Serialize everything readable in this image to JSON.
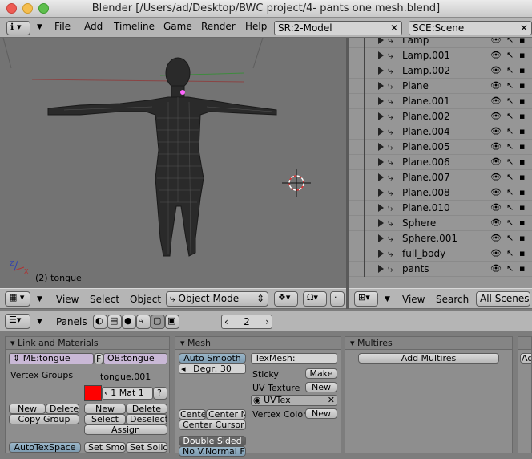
{
  "window": {
    "title": "Blender [/Users/ad/Desktop/BWC project/4- pants one mesh.blend]"
  },
  "topbar": {
    "menus": [
      "File",
      "Add",
      "Timeline",
      "Game",
      "Render",
      "Help"
    ],
    "screen_field": "SR:2-Model",
    "scene_field": "SCE:Scene"
  },
  "viewport": {
    "object_label": "(2) tongue"
  },
  "viewport_header": {
    "menus": [
      "View",
      "Select",
      "Object"
    ],
    "mode": "Object Mode"
  },
  "outliner": {
    "items": [
      {
        "name": "Lamp"
      },
      {
        "name": "Lamp.001"
      },
      {
        "name": "Lamp.002"
      },
      {
        "name": "Plane"
      },
      {
        "name": "Plane.001"
      },
      {
        "name": "Plane.002"
      },
      {
        "name": "Plane.004"
      },
      {
        "name": "Plane.005"
      },
      {
        "name": "Plane.006"
      },
      {
        "name": "Plane.007"
      },
      {
        "name": "Plane.008"
      },
      {
        "name": "Plane.010"
      },
      {
        "name": "Sphere"
      },
      {
        "name": "Sphere.001"
      },
      {
        "name": "full_body"
      },
      {
        "name": "pants"
      }
    ]
  },
  "outliner_header": {
    "menus": [
      "View",
      "Search"
    ],
    "scope": "All Scenes"
  },
  "buttons_header": {
    "panels_label": "Panels",
    "frame_value": "2"
  },
  "link_materials": {
    "title": "Link and Materials",
    "mesh_field": "ME:tongue",
    "f_label": "F",
    "object_field": "OB:tongue",
    "vertex_groups_label": "Vertex Groups",
    "material_name": "tongue.001",
    "mat_label": "1 Mat 1",
    "question_label": "?",
    "vg_new": "New",
    "vg_delete": "Delete",
    "copy_group": "Copy Group",
    "mat_new": "New",
    "mat_delete": "Delete",
    "mat_select": "Select",
    "mat_deselect": "Deselect",
    "assign": "Assign",
    "autotexspace": "AutoTexSpace",
    "set_smooth": "Set Smoo",
    "set_solid": "Set Solid",
    "material_color": "#ff0000"
  },
  "mesh": {
    "title": "Mesh",
    "auto_smooth": "Auto Smooth",
    "degr": "Degr: 30",
    "texmesh": "TexMesh:",
    "sticky": "Sticky",
    "sticky_btn": "Make",
    "uv_texture": "UV Texture",
    "uv_btn": "New",
    "uvtex_name": "UVTex",
    "vertex_color": "Vertex Color",
    "vc_btn": "New",
    "center": "Cente",
    "center_new": "Center Ne",
    "center_cursor": "Center Cursor",
    "double_sided": "Double Sided",
    "no_vnormal_flip": "No V.Normal Flip"
  },
  "multires": {
    "title": "Multires",
    "add_btn": "Add Multires",
    "partial_btn": "Ad"
  },
  "colors": {
    "accent_red": "#ff0000",
    "traffic_close": "#ee5c54",
    "traffic_min": "#f5be4f",
    "traffic_max": "#5ebf4d"
  }
}
